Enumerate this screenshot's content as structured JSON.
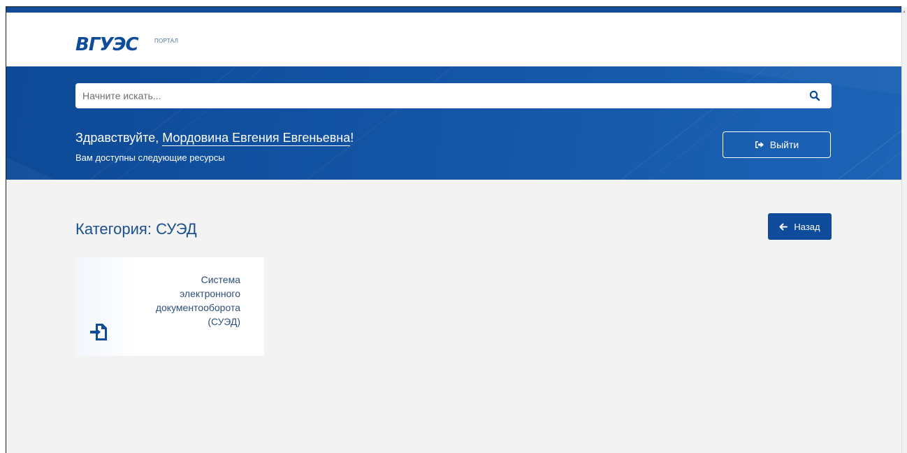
{
  "brand": {
    "logo_text": "ВГУЭС",
    "logo_subtitle": "ПОРТАЛ",
    "color": "#0e4c9b"
  },
  "search": {
    "placeholder": "Начните искать...",
    "value": "",
    "icon": "search-icon"
  },
  "hero": {
    "greeting_prefix": "Здравствуйте, ",
    "user_name": "Мордовина Евгения Евгеньевна",
    "greeting_suffix": "!",
    "subtitle": "Вам доступны следующие ресурсы",
    "logout_label": "Выйти",
    "logout_icon": "sign-out-icon",
    "background_color": "#0e4c9b"
  },
  "category": {
    "title": "Категория: СУЭД",
    "back_label": "Назад",
    "back_icon": "arrow-left-icon"
  },
  "resources": [
    {
      "title_lines": [
        "Система",
        "электронного",
        "документооборота",
        "(СУЭД)"
      ],
      "icon": "sign-in-icon"
    }
  ],
  "colors": {
    "page_background": "#f3f3f3",
    "accent": "#0e4c9b",
    "heading": "#1b4f8f"
  }
}
